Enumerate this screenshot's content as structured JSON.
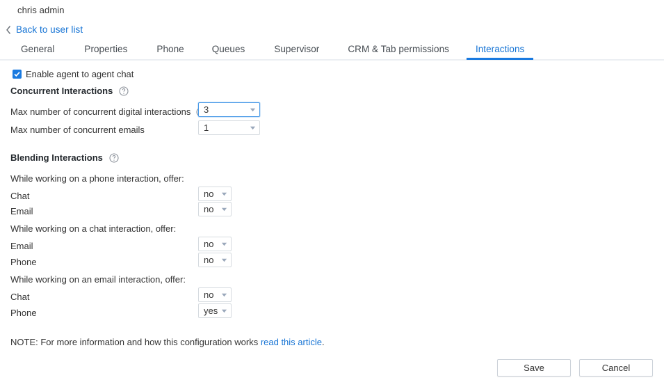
{
  "header": {
    "user_title": "chris admin",
    "back_link": "Back to user list",
    "back_icon": "chevron-left-icon"
  },
  "tabs": [
    {
      "label": "General",
      "active": false
    },
    {
      "label": "Properties",
      "active": false
    },
    {
      "label": "Phone",
      "active": false
    },
    {
      "label": "Queues",
      "active": false
    },
    {
      "label": "Supervisor",
      "active": false
    },
    {
      "label": "CRM & Tab permissions",
      "active": false
    },
    {
      "label": "Interactions",
      "active": true
    }
  ],
  "agent_chat": {
    "label": "Enable agent to agent chat",
    "checked": true
  },
  "concurrent": {
    "heading": "Concurrent Interactions",
    "help_icon": "help-circle-icon",
    "fields": [
      {
        "label": "Max number of concurrent digital interactions",
        "has_help": true,
        "value": "3",
        "focused": true
      },
      {
        "label": "Max number of concurrent emails",
        "has_help": false,
        "value": "1",
        "focused": false
      }
    ]
  },
  "blending": {
    "heading": "Blending Interactions",
    "help_icon": "help-circle-icon",
    "groups": [
      {
        "caption": "While working on a phone interaction, offer:",
        "rows": [
          {
            "label": "Chat",
            "value": "no"
          },
          {
            "label": "Email",
            "value": "no"
          }
        ]
      },
      {
        "caption": "While working on a chat interaction, offer:",
        "rows": [
          {
            "label": "Email",
            "value": "no"
          },
          {
            "label": "Phone",
            "value": "no"
          }
        ]
      },
      {
        "caption": "While working on an email interaction, offer:",
        "rows": [
          {
            "label": "Chat",
            "value": "no"
          },
          {
            "label": "Phone",
            "value": "yes"
          }
        ]
      }
    ]
  },
  "note": {
    "text_before": "NOTE: For more information and how this configuration works ",
    "link_text": "read this article",
    "text_after": "."
  },
  "footer": {
    "save_label": "Save",
    "cancel_label": "Cancel"
  },
  "colors": {
    "accent": "#1a7ae0",
    "link": "#1573d4",
    "text": "#333333",
    "border": "#d6dbe0"
  }
}
